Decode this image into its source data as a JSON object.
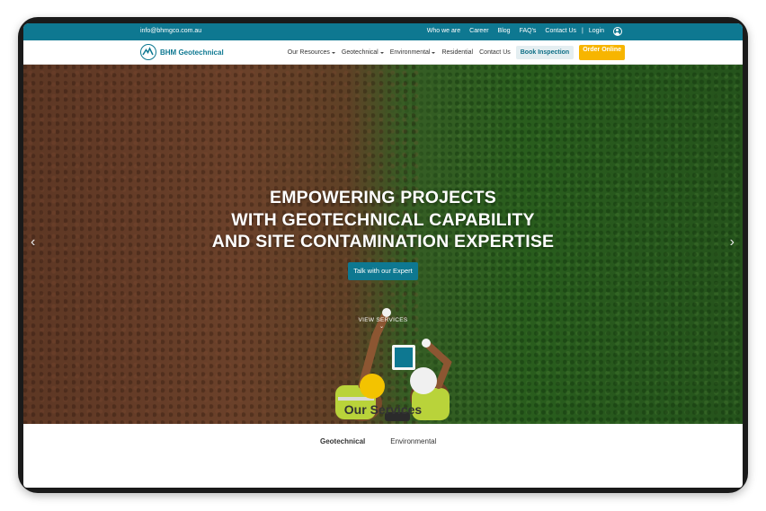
{
  "topbar": {
    "email": "info@bhmgco.com.au",
    "links": [
      "Who we are",
      "Career",
      "Blog",
      "FAQ's",
      "Contact Us"
    ],
    "separator": "|",
    "login": "Login"
  },
  "nav": {
    "logo_text": "BHM Geotechnical",
    "items": [
      {
        "label": "Our Resources",
        "dropdown": true
      },
      {
        "label": "Geotechnical",
        "dropdown": true
      },
      {
        "label": "Environmental",
        "dropdown": true
      },
      {
        "label": "Residential",
        "dropdown": false
      },
      {
        "label": "Contact Us",
        "dropdown": false
      }
    ],
    "book_label": "Book Inspection",
    "order_label": "Order Online"
  },
  "hero": {
    "title_lines": [
      "EMPOWERING PROJECTS",
      "WITH GEOTECHNICAL CAPABILITY",
      "AND SITE CONTAMINATION EXPERTISE"
    ],
    "cta_label": "Talk with our Expert",
    "view_services": "VIEW SERVICES",
    "prev_icon": "chevron-left-icon",
    "next_icon": "chevron-right-icon"
  },
  "services": {
    "title": "Our Services",
    "tabs": [
      "Geotechnical",
      "Environmental"
    ],
    "active_tab": "Geotechnical"
  },
  "colors": {
    "brand": "#0e7891",
    "accent": "#f7b500"
  }
}
